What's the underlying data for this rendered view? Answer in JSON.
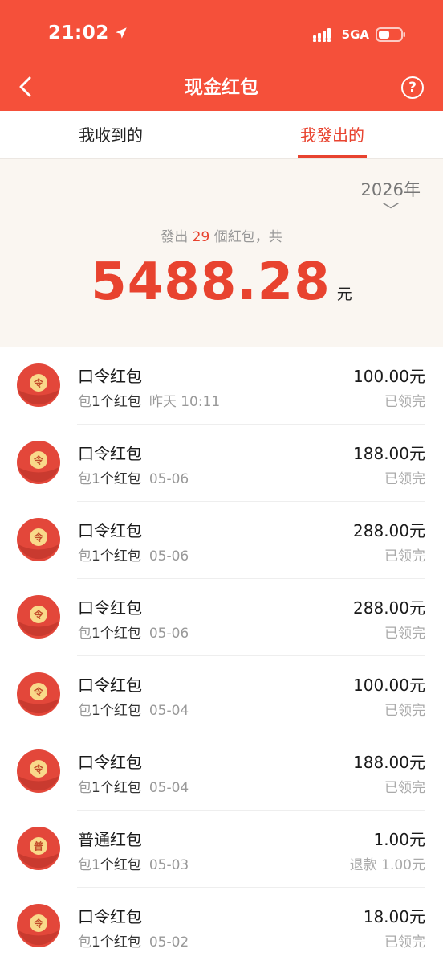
{
  "status_bar": {
    "time": "21:02",
    "network": "5GA"
  },
  "nav": {
    "title": "现金红包",
    "help": "?"
  },
  "tabs": {
    "received": "我收到的",
    "sent": "我發出的"
  },
  "summary": {
    "year": "2026年",
    "prefix": "發出",
    "count": "29",
    "suffix": "個紅包，共",
    "total": "5488.28",
    "unit": "元"
  },
  "colors": {
    "brand": "#f5503a",
    "accent": "#e8432f",
    "envelope": "#e3473a",
    "seal": "#f9d98a"
  },
  "records": [
    {
      "type": "口令红包",
      "seal": "令",
      "pkg": "包",
      "qty": "1个红包",
      "date": "昨天 10:11",
      "amount": "100.00元",
      "status": "已领完"
    },
    {
      "type": "口令红包",
      "seal": "令",
      "pkg": "包",
      "qty": "1个红包",
      "date": "05-06",
      "amount": "188.00元",
      "status": "已领完"
    },
    {
      "type": "口令红包",
      "seal": "令",
      "pkg": "包",
      "qty": "1个红包",
      "date": "05-06",
      "amount": "288.00元",
      "status": "已领完"
    },
    {
      "type": "口令红包",
      "seal": "令",
      "pkg": "包",
      "qty": "1个红包",
      "date": "05-06",
      "amount": "288.00元",
      "status": "已领完"
    },
    {
      "type": "口令红包",
      "seal": "令",
      "pkg": "包",
      "qty": "1个红包",
      "date": "05-04",
      "amount": "100.00元",
      "status": "已领完"
    },
    {
      "type": "口令红包",
      "seal": "令",
      "pkg": "包",
      "qty": "1个红包",
      "date": "05-04",
      "amount": "188.00元",
      "status": "已领完"
    },
    {
      "type": "普通红包",
      "seal": "普",
      "pkg": "包",
      "qty": "1个红包",
      "date": "05-03",
      "amount": "1.00元",
      "status": "退款 1.00元"
    },
    {
      "type": "口令红包",
      "seal": "令",
      "pkg": "包",
      "qty": "1个红包",
      "date": "05-02",
      "amount": "18.00元",
      "status": "已领完"
    }
  ]
}
